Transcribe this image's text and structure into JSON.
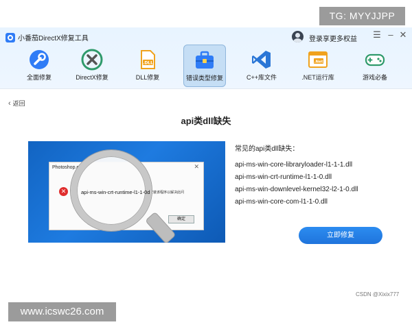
{
  "watermarks": {
    "top": "TG: MYYJJPP",
    "bottom": "www.icswc26.com"
  },
  "app": {
    "title": "小番茄DirectX修复工具",
    "login": "登录享更多权益",
    "window_controls": {
      "menu": "☰",
      "minimize": "–",
      "close": "✕"
    }
  },
  "nav": [
    {
      "label": "全面修复",
      "icon": "wrench-icon",
      "active": false
    },
    {
      "label": "DirectX修复",
      "icon": "directx-icon",
      "active": false
    },
    {
      "label": "DLL修复",
      "icon": "dll-file-icon",
      "active": false
    },
    {
      "label": "错误类型修复",
      "icon": "toolbox-icon",
      "active": true
    },
    {
      "label": "C++库文件",
      "icon": "visual-studio-icon",
      "active": false
    },
    {
      "label": ".NET运行库",
      "icon": "dotnet-window-icon",
      "active": false
    },
    {
      "label": "游戏必备",
      "icon": "gamepad-icon",
      "active": false
    }
  ],
  "back": "返回",
  "page_title": "api类dll缺失",
  "example_image": {
    "dialog_title": "Photoshop.e",
    "dialog_text": "安装该程序以解决此问",
    "ok_button": "确定",
    "magnified_text": "api-ms-win-crt-runtime-l1-1-0d"
  },
  "dll_list": {
    "heading": "常见的api类dll缺失：",
    "items": [
      "api-ms-win-core-libraryloader-l1-1-1.dll",
      "api-ms-win-crt-runtime-l1-1-0.dll",
      "api-ms-win-downlevel-kernel32-l2-1-0.dll",
      "api-ms-win-core-com-l1-1-0.dll"
    ]
  },
  "repair_button": "立即修复",
  "credit": "CSDN @Xixix777",
  "colors": {
    "accent": "#2f7cf6",
    "active_tab": "#c5def5",
    "button": "#1f74dc",
    "error_red": "#e02d2d"
  }
}
